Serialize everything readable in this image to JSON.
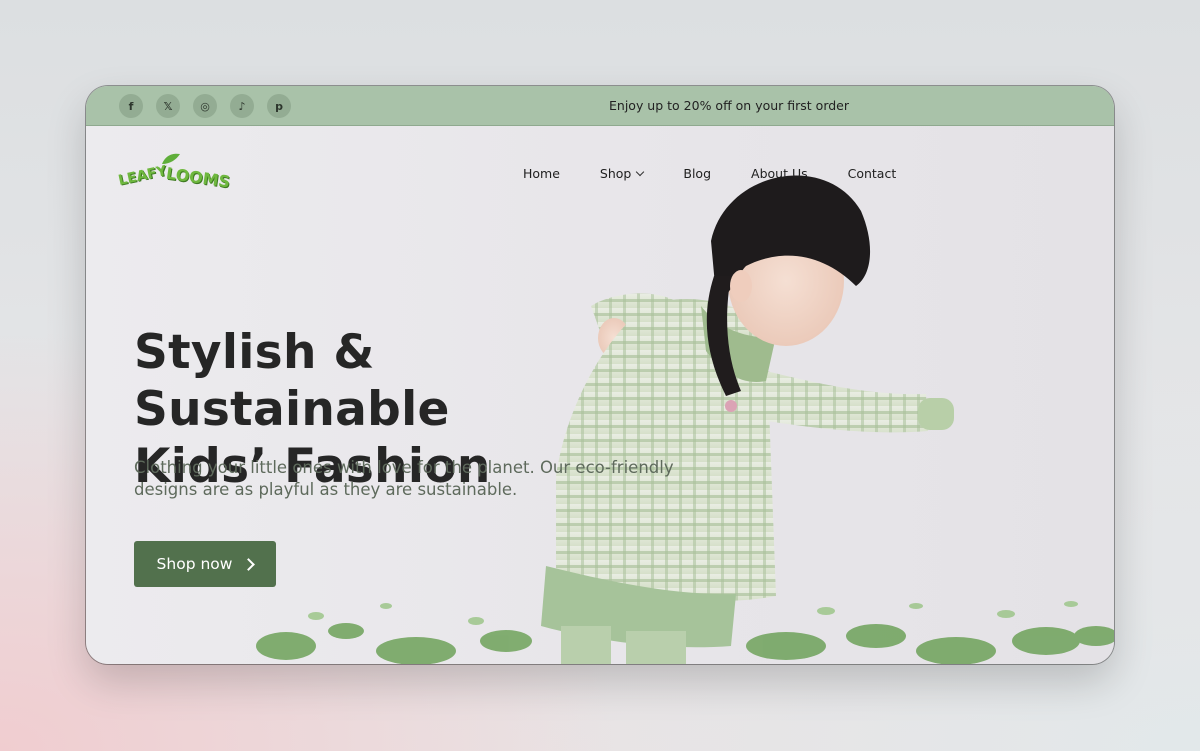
{
  "topbar": {
    "promo_text": "Enjoy up to 20% off on your  first order",
    "socials": [
      {
        "icon": "facebook-icon",
        "glyph": "f"
      },
      {
        "icon": "x-twitter-icon",
        "glyph": "𝕏"
      },
      {
        "icon": "instagram-icon",
        "glyph": "◎"
      },
      {
        "icon": "tiktok-icon",
        "glyph": "♪"
      },
      {
        "icon": "pinterest-icon",
        "glyph": "p"
      }
    ]
  },
  "brand": {
    "logo_word_1": "LEAFY",
    "logo_word_2": "LOOMS",
    "color": "#6fb83f"
  },
  "nav": {
    "home": "Home",
    "shop": "Shop",
    "blog": "Blog",
    "about": "About Us",
    "contact": "Contact"
  },
  "hero": {
    "headline_line1": "Stylish & Sustainable",
    "headline_line2": "Kids’ Fashion",
    "subtext": "Clothing your little ones with love for the planet. Our eco-friendly designs are as playful as they are sustainable.",
    "cta_label": "Shop now",
    "accent_color": "#52714d",
    "bar_color": "#a9c2a9"
  }
}
